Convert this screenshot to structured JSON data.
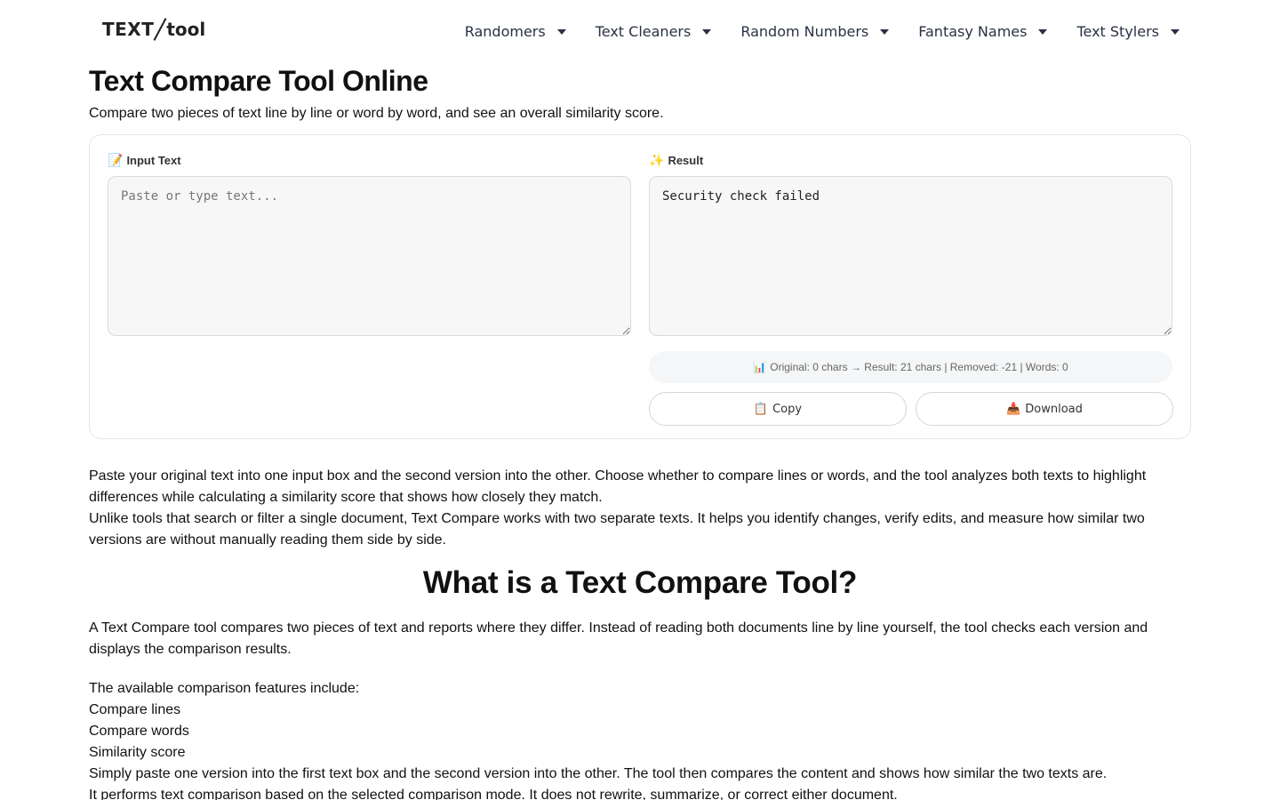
{
  "header": {
    "logo_part1": "TEXT",
    "logo_part2": "tool",
    "nav": [
      {
        "label": "Randomers"
      },
      {
        "label": "Text Cleaners"
      },
      {
        "label": "Random Numbers"
      },
      {
        "label": "Fantasy Names"
      },
      {
        "label": "Text Stylers"
      }
    ]
  },
  "intro": {
    "title": "Text Compare Tool Online",
    "subtitle": "Compare two pieces of text line by line or word by word, and see an overall similarity score."
  },
  "tool": {
    "input_label": "Input Text",
    "input_label_icon": "📝",
    "input_placeholder": "Paste or type text...",
    "input_value": "",
    "result_label": "Result",
    "result_label_icon": "✨",
    "result_value": "Security check failed",
    "stats_icon": "📊",
    "stats_text": "Original: 0 chars → Result: 21 chars | Removed: -21 | Words: 0",
    "copy_icon": "📋",
    "copy_label": "Copy",
    "download_icon": "📥",
    "download_label": "Download"
  },
  "content": {
    "p1": "Paste your original text into one input box and the second version into the other. Choose whether to compare lines or words, and the tool analyzes both texts to highlight differences while calculating a similarity score that shows how closely they match.",
    "p2": "Unlike tools that search or filter a single document, Text Compare works with two separate texts. It helps you identify changes, verify edits, and measure how similar two versions are without manually reading them side by side.",
    "h2": "What is a Text Compare Tool?",
    "p3": "A Text Compare tool compares two pieces of text and reports where they differ. Instead of reading both documents line by line yourself, the tool checks each version and displays the comparison results.",
    "features_intro": "The available comparison features include:",
    "features": [
      "Compare lines",
      "Compare words",
      "Similarity score"
    ],
    "p4": "Simply paste one version into the first text box and the second version into the other. The tool then compares the content and shows how similar the two texts are.",
    "p5": "It performs text comparison based on the selected comparison mode. It does not rewrite, summarize, or correct either document."
  }
}
